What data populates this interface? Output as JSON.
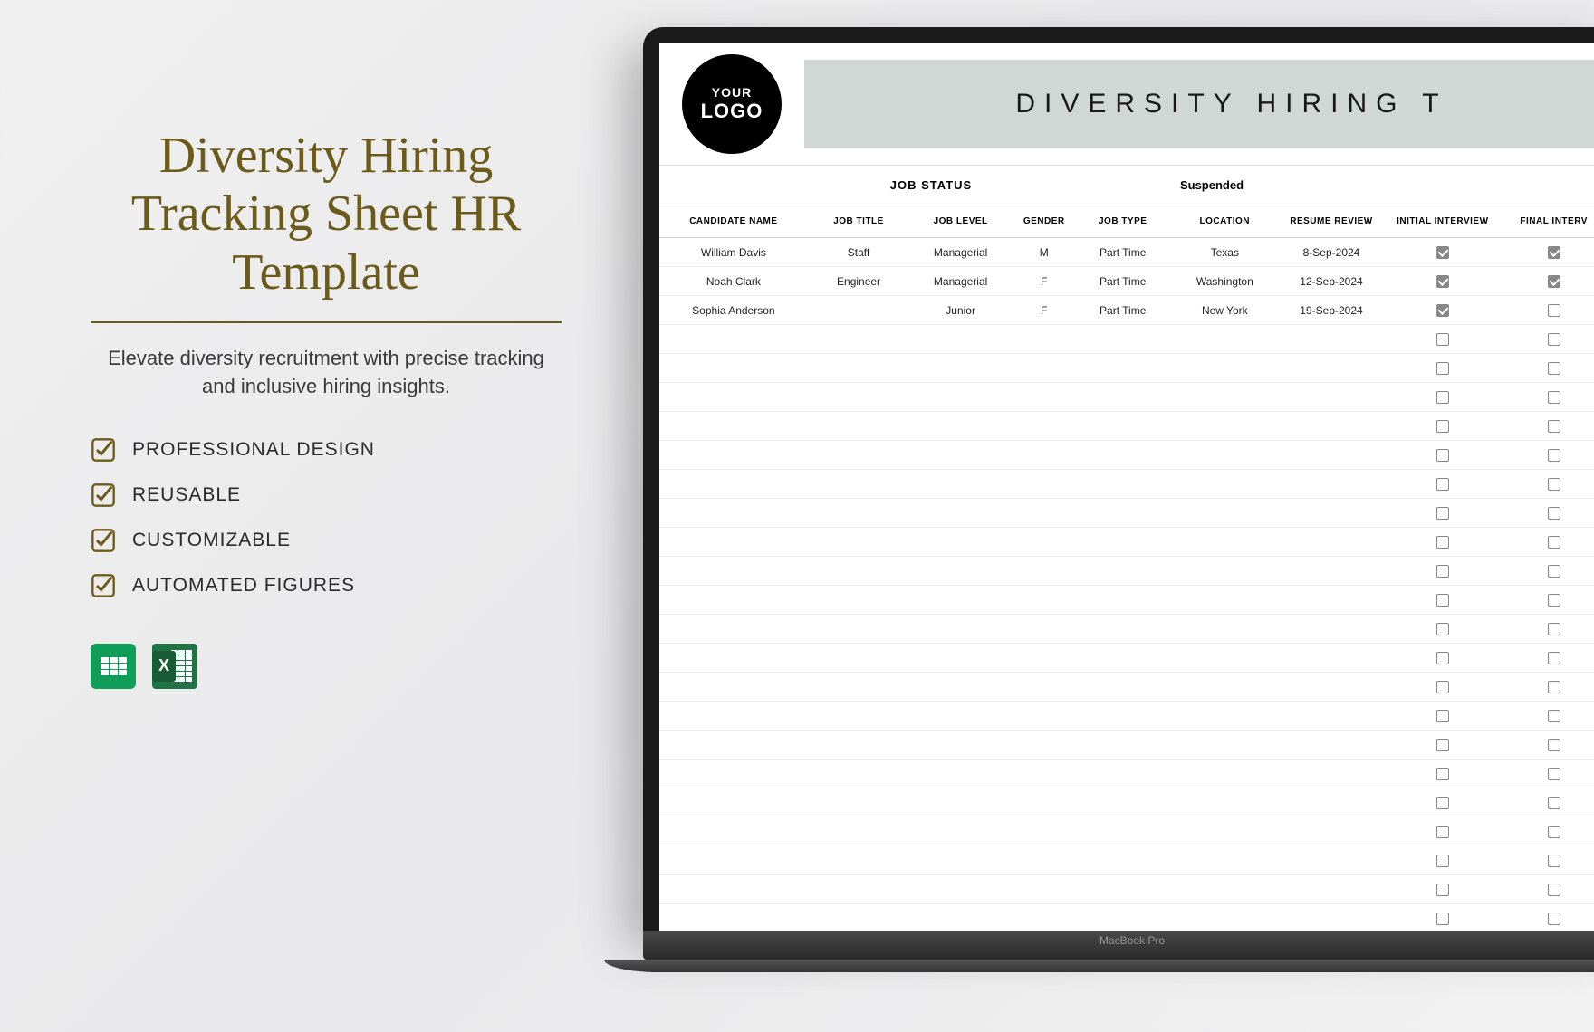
{
  "promo": {
    "title": "Diversity Hiring Tracking Sheet HR Template",
    "subtitle": "Elevate diversity recruitment with precise tracking and inclusive hiring insights.",
    "features": [
      "PROFESSIONAL DESIGN",
      "REUSABLE",
      "CUSTOMIZABLE",
      "AUTOMATED FIGURES"
    ]
  },
  "laptop": {
    "brand": "MacBook Pro"
  },
  "sheet": {
    "logo_line1": "YOUR",
    "logo_line2": "LOGO",
    "banner_title": "DIVERSITY HIRING T",
    "job_status_label": "JOB STATUS",
    "job_status_value": "Suspended",
    "columns": [
      "CANDIDATE NAME",
      "JOB TITLE",
      "JOB LEVEL",
      "GENDER",
      "JOB TYPE",
      "LOCATION",
      "RESUME REVIEW",
      "INITIAL INTERVIEW",
      "FINAL INTERV"
    ],
    "rows": [
      {
        "name": "William Davis",
        "title": "Staff",
        "level": "Managerial",
        "gender": "M",
        "type": "Part Time",
        "location": "Texas",
        "resume": "8-Sep-2024",
        "initial": true,
        "final": true
      },
      {
        "name": "Noah Clark",
        "title": "Engineer",
        "level": "Managerial",
        "gender": "F",
        "type": "Part Time",
        "location": "Washington",
        "resume": "12-Sep-2024",
        "initial": true,
        "final": true
      },
      {
        "name": "Sophia Anderson",
        "title": "",
        "level": "Junior",
        "gender": "F",
        "type": "Part Time",
        "location": "New York",
        "resume": "19-Sep-2024",
        "initial": true,
        "final": false
      }
    ],
    "empty_rows": 22
  }
}
